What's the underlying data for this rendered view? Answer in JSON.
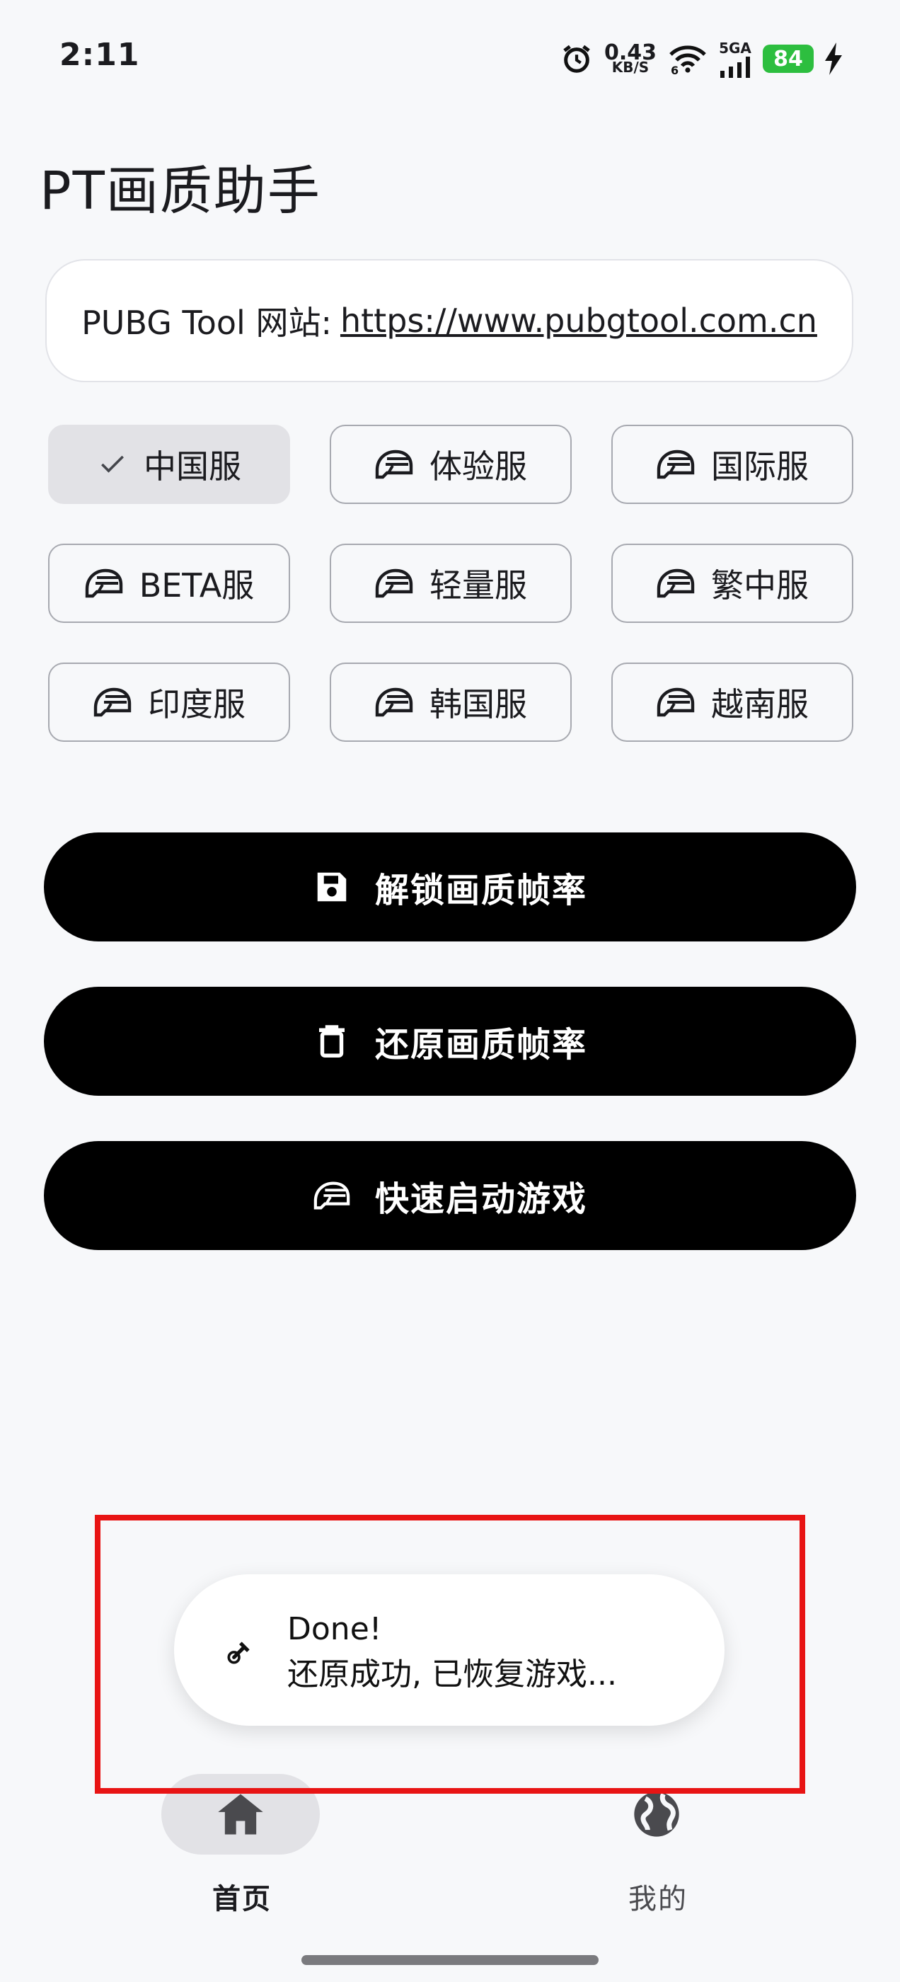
{
  "status_bar": {
    "time": "2:11",
    "net_speed_value": "0.43",
    "net_speed_unit": "KB/S",
    "wifi_sub": "6",
    "signal_label": "5GA",
    "battery": "84"
  },
  "app": {
    "title": "PT画质助手"
  },
  "website": {
    "label": "PUBG Tool 网站:",
    "url": "https://www.pubgtool.com.cn"
  },
  "servers": [
    {
      "label": "中国服",
      "selected": true,
      "icon": "check-icon"
    },
    {
      "label": "体验服",
      "selected": false,
      "icon": "helmet-icon"
    },
    {
      "label": "国际服",
      "selected": false,
      "icon": "helmet-icon"
    },
    {
      "label": "BETA服",
      "selected": false,
      "icon": "helmet-icon"
    },
    {
      "label": "轻量服",
      "selected": false,
      "icon": "helmet-icon"
    },
    {
      "label": "繁中服",
      "selected": false,
      "icon": "helmet-icon"
    },
    {
      "label": "印度服",
      "selected": false,
      "icon": "helmet-icon"
    },
    {
      "label": "韩国服",
      "selected": false,
      "icon": "helmet-icon"
    },
    {
      "label": "越南服",
      "selected": false,
      "icon": "helmet-icon"
    }
  ],
  "actions": [
    {
      "label": "解锁画质帧率",
      "icon": "save-icon"
    },
    {
      "label": "还原画质帧率",
      "icon": "trash-icon"
    },
    {
      "label": "快速启动游戏",
      "icon": "helmet-icon"
    }
  ],
  "toast": {
    "title": "Done!",
    "message": "还原成功, 已恢复游戏...",
    "icon": "tools-icon"
  },
  "bottom_nav": [
    {
      "label": "首页",
      "icon": "home-icon",
      "active": true
    },
    {
      "label": "我的",
      "icon": "globe-icon",
      "active": false
    }
  ],
  "colors": {
    "background": "#f7f8fa",
    "button": "#000000",
    "highlight": "#e81414",
    "battery": "#2dbe3f"
  }
}
